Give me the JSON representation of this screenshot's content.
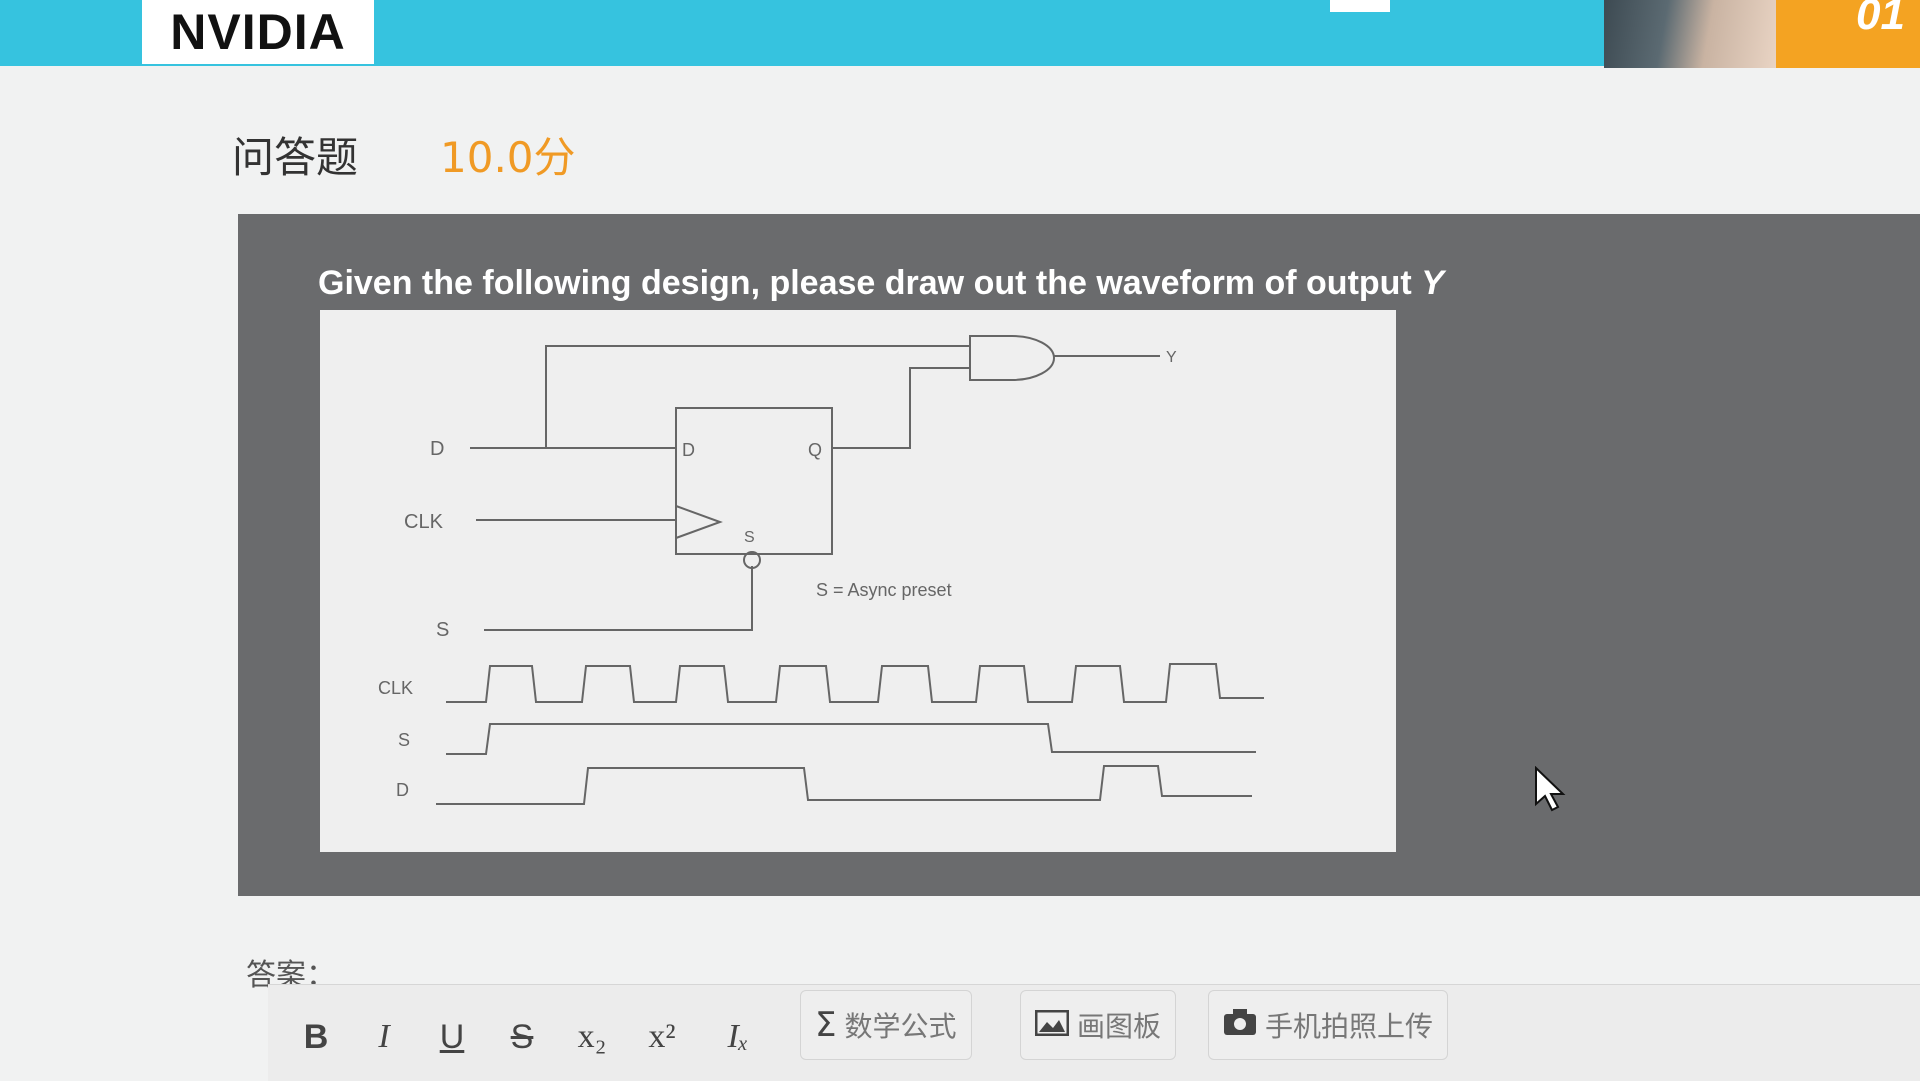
{
  "header": {
    "logo_text": "NVIDIA",
    "timer_text": "01"
  },
  "question": {
    "type_label": "问答题",
    "score_label": "10.0分",
    "prompt_prefix": "Given the following design, please draw out the waveform of output ",
    "prompt_var": "Y"
  },
  "figure": {
    "labels": {
      "in_d": "D",
      "in_clk": "CLK",
      "in_s": "S",
      "ff_d": "D",
      "ff_q": "Q",
      "ff_s": "S",
      "out_y": "Y",
      "note": "S = Async preset",
      "wave_clk": "CLK",
      "wave_s": "S",
      "wave_d": "D"
    }
  },
  "answer": {
    "label": "答案："
  },
  "toolbar": {
    "bold": "B",
    "italic": "I",
    "underline": "U",
    "strike": "S",
    "subscript": "x₂",
    "superscript": "x²",
    "clear_format": "Iₓ",
    "formula_label": "数学公式",
    "drawing_label": "画图板",
    "phone_upload_label": "手机拍照上传"
  }
}
